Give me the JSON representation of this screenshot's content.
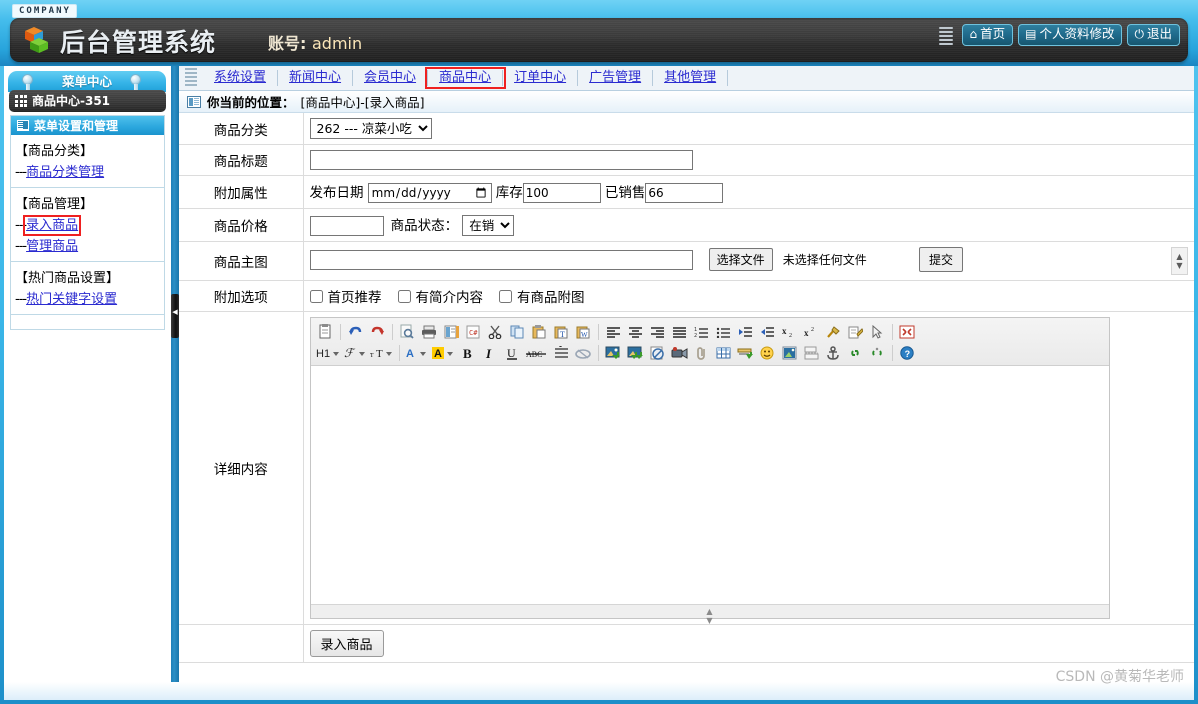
{
  "header": {
    "company_tag": "COMPANY",
    "system_title": "后台管理系统",
    "account_label": "账号:",
    "account_value": "admin",
    "buttons": [
      {
        "icon": "home-icon",
        "glyph": "⌂",
        "label": "首页"
      },
      {
        "icon": "document-icon",
        "glyph": "▤",
        "label": "个人资料修改"
      },
      {
        "icon": "power-icon",
        "glyph": "⏻",
        "label": "退出"
      }
    ]
  },
  "sidebar": {
    "menu_center_title": "菜单中心",
    "current_module": "商品中心-351",
    "panel_title": "菜单设置和管理",
    "groups": [
      {
        "title": "【商品分类】",
        "links": [
          {
            "dash": "---",
            "label": "商品分类管理",
            "highlighted": false
          }
        ]
      },
      {
        "title": "【商品管理】",
        "links": [
          {
            "dash": "---",
            "label": "录入商品",
            "highlighted": true
          },
          {
            "dash": "---",
            "label": "管理商品",
            "highlighted": false
          }
        ]
      },
      {
        "title": "【热门商品设置】",
        "links": [
          {
            "dash": "---",
            "label": "热门关键字设置",
            "highlighted": false
          }
        ]
      }
    ]
  },
  "tabs": [
    {
      "label": "系统设置",
      "selected": false
    },
    {
      "label": "新闻中心",
      "selected": false
    },
    {
      "label": "会员中心",
      "selected": false
    },
    {
      "label": "商品中心",
      "selected": true
    },
    {
      "label": "订单中心",
      "selected": false
    },
    {
      "label": "广告管理",
      "selected": false
    },
    {
      "label": "其他管理",
      "selected": false
    }
  ],
  "breadcrumb": {
    "prefix": "你当前的位置：",
    "location": "[商品中心]-[录入商品]"
  },
  "form": {
    "rows": {
      "category": {
        "label": "商品分类",
        "selected": "262 --- 凉菜小吃",
        "options": [
          "262 --- 凉菜小吃"
        ]
      },
      "title": {
        "label": "商品标题",
        "value": "",
        "placeholder": ""
      },
      "attributes": {
        "label": "附加属性",
        "date_label": "发布日期",
        "date_value": "",
        "date_placeholder": "年 /月/日",
        "stock_label": "库存",
        "stock_value": "100",
        "sold_label": "已销售",
        "sold_value": "66"
      },
      "price": {
        "label": "商品价格",
        "value": "",
        "status_label": "商品状态：",
        "status_selected": "在销",
        "status_options": [
          "在销"
        ]
      },
      "main_image": {
        "label": "商品主图",
        "value": "",
        "choose_button": "选择文件",
        "file_status": "未选择任何文件",
        "submit_button": "提交"
      },
      "extra_options": {
        "label": "附加选项",
        "checkboxes": [
          {
            "label": "首页推荐",
            "checked": false
          },
          {
            "label": "有简介内容",
            "checked": false
          },
          {
            "label": "有商品附图",
            "checked": false
          }
        ]
      },
      "detail": {
        "label": "详细内容",
        "content": ""
      }
    },
    "submit_button": "录入商品"
  },
  "editor": {
    "toolbar_row1": [
      {
        "name": "paste-from-clipboard-icon",
        "glyph": "📋"
      },
      {
        "name": "separator",
        "glyph": ""
      },
      {
        "name": "undo-icon",
        "glyph": "↺"
      },
      {
        "name": "redo-icon",
        "glyph": "↻"
      },
      {
        "name": "separator",
        "glyph": ""
      },
      {
        "name": "preview-icon",
        "glyph": "🔍"
      },
      {
        "name": "print-icon",
        "glyph": "🖶"
      },
      {
        "name": "template-icon",
        "glyph": "▤"
      },
      {
        "name": "source-code-icon",
        "glyph": "C#"
      },
      {
        "name": "cut-icon",
        "glyph": "✂"
      },
      {
        "name": "copy-icon",
        "glyph": "⎘"
      },
      {
        "name": "paste-icon",
        "glyph": "📌"
      },
      {
        "name": "paste-text-icon",
        "glyph": "T"
      },
      {
        "name": "paste-word-icon",
        "glyph": "W"
      },
      {
        "name": "separator",
        "glyph": ""
      },
      {
        "name": "align-left-icon",
        "glyph": "≡"
      },
      {
        "name": "align-center-icon",
        "glyph": "≡"
      },
      {
        "name": "align-right-icon",
        "glyph": "≡"
      },
      {
        "name": "align-justify-icon",
        "glyph": "≡"
      },
      {
        "name": "ordered-list-icon",
        "glyph": "≔"
      },
      {
        "name": "unordered-list-icon",
        "glyph": "⁝"
      },
      {
        "name": "indent-icon",
        "glyph": "⇥"
      },
      {
        "name": "outdent-icon",
        "glyph": "⇤"
      },
      {
        "name": "subscript-icon",
        "glyph": "x₂"
      },
      {
        "name": "superscript-icon",
        "glyph": "x²"
      },
      {
        "name": "remove-format-icon",
        "glyph": "🖌"
      },
      {
        "name": "format-painter-icon",
        "glyph": "🖊"
      },
      {
        "name": "select-all-icon",
        "glyph": "⟰"
      },
      {
        "name": "separator",
        "glyph": ""
      },
      {
        "name": "fullscreen-icon",
        "glyph": "⛶"
      }
    ],
    "toolbar_row2": [
      {
        "name": "heading-icon",
        "glyph": "H1"
      },
      {
        "name": "font-family-icon",
        "glyph": "ℱ"
      },
      {
        "name": "font-size-icon",
        "glyph": "тT"
      },
      {
        "name": "separator",
        "glyph": ""
      },
      {
        "name": "text-color-icon",
        "glyph": "A"
      },
      {
        "name": "background-color-icon",
        "glyph": "A"
      },
      {
        "name": "bold-icon",
        "glyph": "B"
      },
      {
        "name": "italic-icon",
        "glyph": "I"
      },
      {
        "name": "underline-icon",
        "glyph": "U"
      },
      {
        "name": "strikethrough-icon",
        "glyph": "ABC"
      },
      {
        "name": "line-height-icon",
        "glyph": "↕"
      },
      {
        "name": "eraser-icon",
        "glyph": "⌫"
      },
      {
        "name": "separator",
        "glyph": ""
      },
      {
        "name": "insert-image-icon",
        "glyph": "🖼"
      },
      {
        "name": "multi-image-icon",
        "glyph": "🖼"
      },
      {
        "name": "flash-icon",
        "glyph": "⊘"
      },
      {
        "name": "video-icon",
        "glyph": "📹"
      },
      {
        "name": "attachment-icon",
        "glyph": "📎"
      },
      {
        "name": "table-icon",
        "glyph": "▦"
      },
      {
        "name": "insert-row-icon",
        "glyph": "⊟"
      },
      {
        "name": "emoticon-icon",
        "glyph": "☺"
      },
      {
        "name": "background-image-icon",
        "glyph": "▣"
      },
      {
        "name": "page-break-icon",
        "glyph": "⊡"
      },
      {
        "name": "anchor-icon",
        "glyph": "⚓"
      },
      {
        "name": "link-icon",
        "glyph": "🔗"
      },
      {
        "name": "unlink-icon",
        "glyph": "⛓"
      },
      {
        "name": "separator",
        "glyph": ""
      },
      {
        "name": "help-icon",
        "glyph": "?"
      }
    ]
  },
  "watermark": "CSDN @黄菊华老师",
  "colors": {
    "brand_blue": "#2aa6dd",
    "link_blue": "#2b2bd0",
    "highlight_red": "#ef2020",
    "header_dark": "#2c2c2c"
  }
}
